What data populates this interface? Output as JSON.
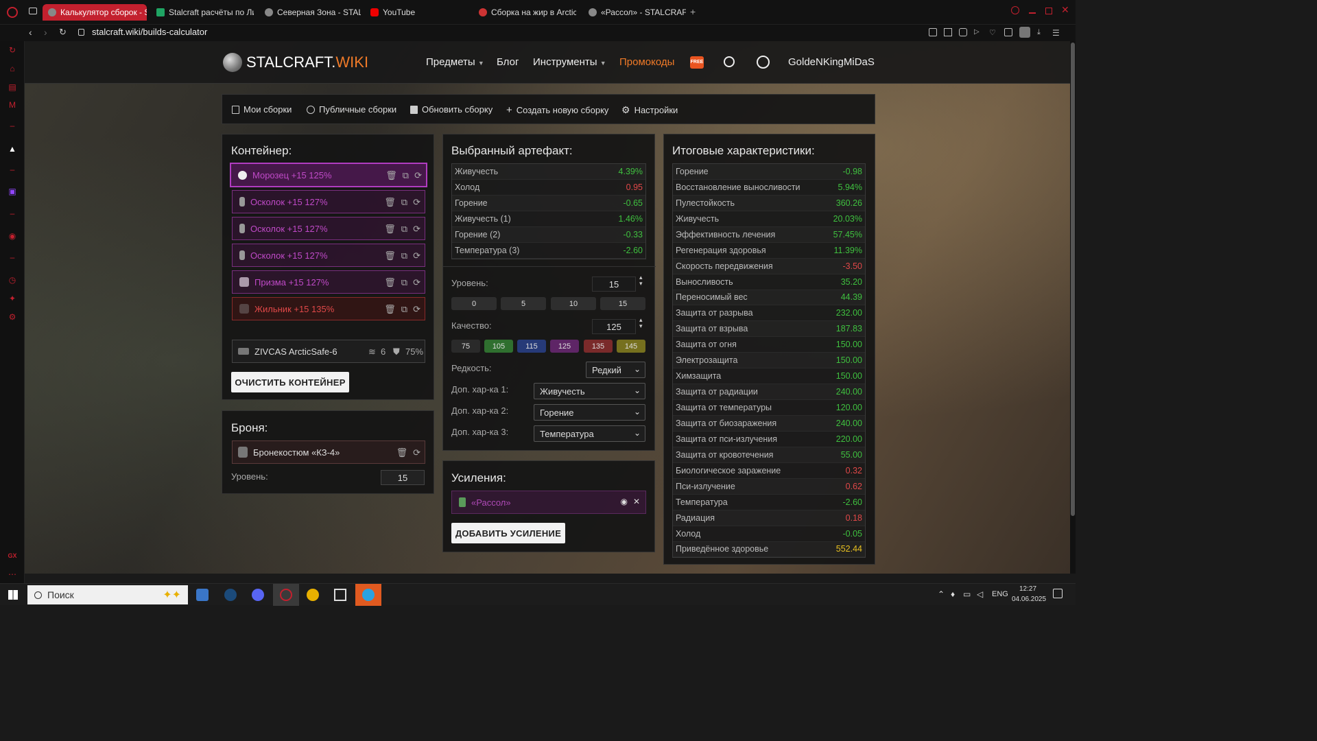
{
  "browser": {
    "tabs": [
      {
        "label": "Калькулятор сборок - ST",
        "active": true
      },
      {
        "label": "Stalcraft расчёты по Лим"
      },
      {
        "label": "Северная Зона - STALCR"
      },
      {
        "label": "YouTube"
      },
      {
        "label": "Сборка на жир в Arctic s"
      },
      {
        "label": "«Рассол» - STALCRAFT.V"
      }
    ],
    "url": "stalcraft.wiki/builds-calculator"
  },
  "header": {
    "logo_main": "STALCRAFT.",
    "logo_accent": "WIKI",
    "nav": [
      "Предметы",
      "Блог",
      "Инструменты",
      "Промокоды"
    ],
    "free_badge": "FREE",
    "username": "GoldeNKingMiDaS"
  },
  "toolbar": {
    "my_builds": "Мои сборки",
    "public_builds": "Публичные сборки",
    "update_build": "Обновить сборку",
    "new_build": "Создать новую сборку",
    "settings": "Настройки"
  },
  "container": {
    "title": "Контейнер:",
    "slots": [
      {
        "name": "Морозец +15 125%"
      },
      {
        "name": "Осколок +15 127%"
      },
      {
        "name": "Осколок +15 127%"
      },
      {
        "name": "Осколок +15 127%"
      },
      {
        "name": "Призма +15 127%"
      },
      {
        "name": "Жильник +15 135%"
      }
    ],
    "case_name": "ZIVCAS ArcticSafe-6",
    "case_slots": "6",
    "case_protection": "75%",
    "clear_button": "ОЧИСТИТЬ КОНТЕЙНЕР"
  },
  "armor": {
    "title": "Броня:",
    "name": "Бронекостюм «КЗ-4»",
    "level_label": "Уровень:",
    "level_value": "15"
  },
  "artifact": {
    "title": "Выбранный артефакт:",
    "stats": [
      {
        "name": "Живучесть",
        "value": "4.39%",
        "color": "g"
      },
      {
        "name": "Холод",
        "value": "0.95",
        "color": "r"
      },
      {
        "name": "Горение",
        "value": "-0.65",
        "color": "g"
      },
      {
        "name": "Живучесть (1)",
        "value": "1.46%",
        "color": "g"
      },
      {
        "name": "Горение (2)",
        "value": "-0.33",
        "color": "g"
      },
      {
        "name": "Температура (3)",
        "value": "-2.60",
        "color": "g"
      }
    ],
    "level_label": "Уровень:",
    "level_value": "15",
    "level_presets": [
      "0",
      "5",
      "10",
      "15"
    ],
    "quality_label": "Качество:",
    "quality_value": "125",
    "quality_presets": [
      {
        "label": "75",
        "color": "#2a2a2a"
      },
      {
        "label": "105",
        "color": "#2f6f2f"
      },
      {
        "label": "115",
        "color": "#263a78"
      },
      {
        "label": "125",
        "color": "#5e2566"
      },
      {
        "label": "135",
        "color": "#7a2a2a"
      },
      {
        "label": "145",
        "color": "#76701e"
      }
    ],
    "rarity_label": "Редкость:",
    "rarity_value": "Редкий",
    "extra1_label": "Доп. хар-ка 1:",
    "extra1_value": "Живучесть",
    "extra2_label": "Доп. хар-ка 2:",
    "extra2_value": "Горение",
    "extra3_label": "Доп. хар-ка 3:",
    "extra3_value": "Температура"
  },
  "boosts": {
    "title": "Усиления:",
    "item": "«Рассол»",
    "add_button": "ДОБАВИТЬ УСИЛЕНИЕ"
  },
  "totals": {
    "title": "Итоговые характеристики:",
    "stats": [
      {
        "name": "Горение",
        "value": "-0.98",
        "color": "g"
      },
      {
        "name": "Восстановление выносливости",
        "value": "5.94%",
        "color": "g"
      },
      {
        "name": "Пулестойкость",
        "value": "360.26",
        "color": "g"
      },
      {
        "name": "Живучесть",
        "value": "20.03%",
        "color": "g"
      },
      {
        "name": "Эффективность лечения",
        "value": "57.45%",
        "color": "g"
      },
      {
        "name": "Регенерация здоровья",
        "value": "11.39%",
        "color": "g"
      },
      {
        "name": "Скорость передвижения",
        "value": "-3.50",
        "color": "r"
      },
      {
        "name": "Выносливость",
        "value": "35.20",
        "color": "g"
      },
      {
        "name": "Переносимый вес",
        "value": "44.39",
        "color": "g"
      },
      {
        "name": "Защита от разрыва",
        "value": "232.00",
        "color": "g"
      },
      {
        "name": "Защита от взрыва",
        "value": "187.83",
        "color": "g"
      },
      {
        "name": "Защита от огня",
        "value": "150.00",
        "color": "g"
      },
      {
        "name": "Электрозащита",
        "value": "150.00",
        "color": "g"
      },
      {
        "name": "Химзащита",
        "value": "150.00",
        "color": "g"
      },
      {
        "name": "Защита от радиации",
        "value": "240.00",
        "color": "g"
      },
      {
        "name": "Защита от температуры",
        "value": "120.00",
        "color": "g"
      },
      {
        "name": "Защита от биозаражения",
        "value": "240.00",
        "color": "g"
      },
      {
        "name": "Защита от пси-излучения",
        "value": "220.00",
        "color": "g"
      },
      {
        "name": "Защита от кровотечения",
        "value": "55.00",
        "color": "g"
      },
      {
        "name": "Биологическое заражение",
        "value": "0.32",
        "color": "r"
      },
      {
        "name": "Пси-излучение",
        "value": "0.62",
        "color": "r"
      },
      {
        "name": "Температура",
        "value": "-2.60",
        "color": "g"
      },
      {
        "name": "Радиация",
        "value": "0.18",
        "color": "r"
      },
      {
        "name": "Холод",
        "value": "-0.05",
        "color": "g"
      },
      {
        "name": "Приведённое здоровье",
        "value": "552.44",
        "color": "y"
      }
    ]
  },
  "taskbar": {
    "search_placeholder": "Поиск",
    "lang": "ENG",
    "time": "12:27",
    "date": "04.06.2025"
  }
}
